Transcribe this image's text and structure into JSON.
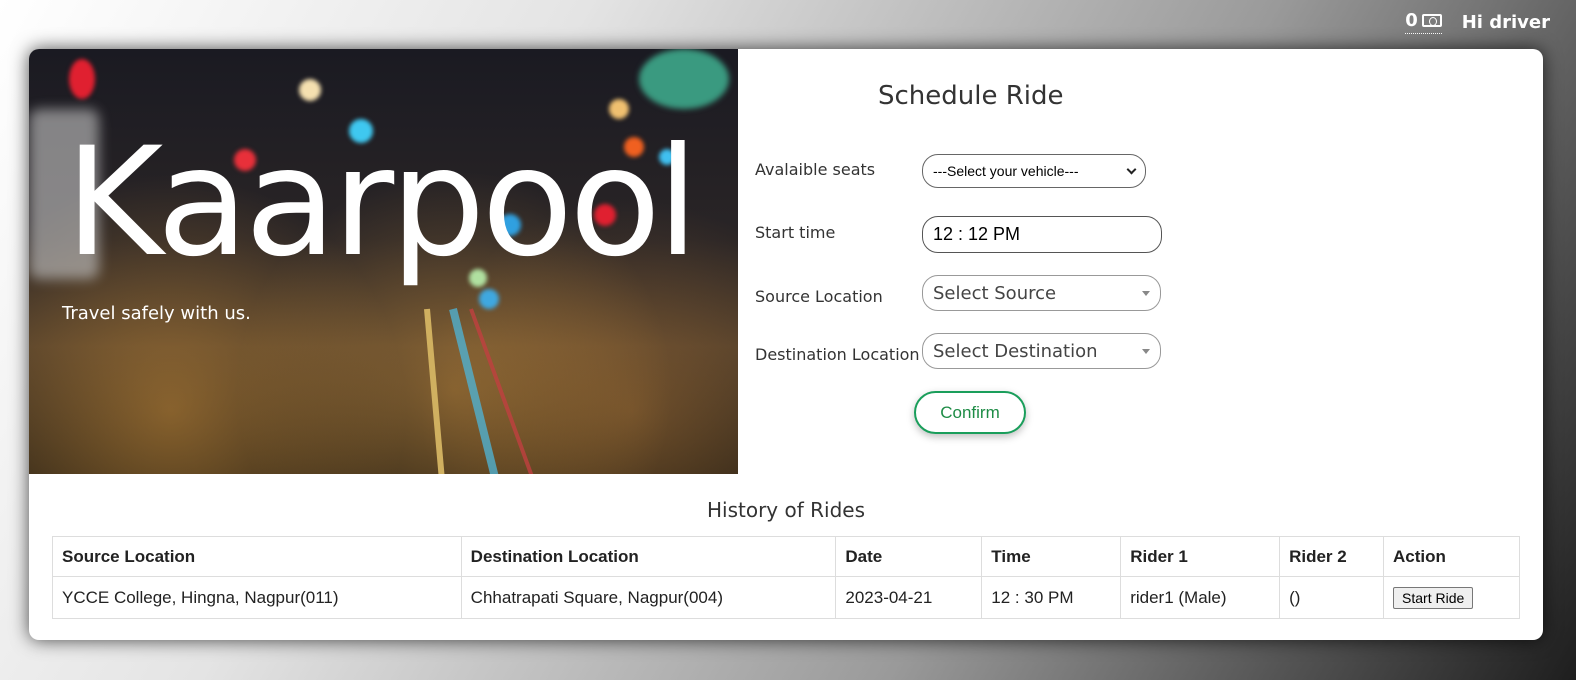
{
  "header": {
    "wallet_balance": "0",
    "wallet_icon": "money-icon",
    "greeting": "Hi driver"
  },
  "hero": {
    "title": "Kaarpool",
    "tagline": "Travel safely with us."
  },
  "form": {
    "title": "Schedule Ride",
    "fields": {
      "seats": {
        "label": "Avalaible seats",
        "value": "---Select your vehicle---"
      },
      "start_time": {
        "label": "Start time",
        "value": "12 : 12 PM"
      },
      "source": {
        "label": "Source Location",
        "value": "Select Source"
      },
      "destination": {
        "label": "Destination Location",
        "value": "Select Destination"
      }
    },
    "confirm_label": "Confirm"
  },
  "history": {
    "title": "History of Rides",
    "columns": [
      "Source Location",
      "Destination Location",
      "Date",
      "Time",
      "Rider 1",
      "Rider 2",
      "Action"
    ],
    "rows": [
      {
        "source": "YCCE College, Hingna, Nagpur(011)",
        "destination": "Chhatrapati Square, Nagpur(004)",
        "date": "2023-04-21",
        "time": "12 : 30 PM",
        "rider1": "rider1 (Male)",
        "rider2": "()",
        "action": "Start Ride"
      }
    ]
  },
  "colors": {
    "confirm_accent": "#1a9e5b"
  }
}
